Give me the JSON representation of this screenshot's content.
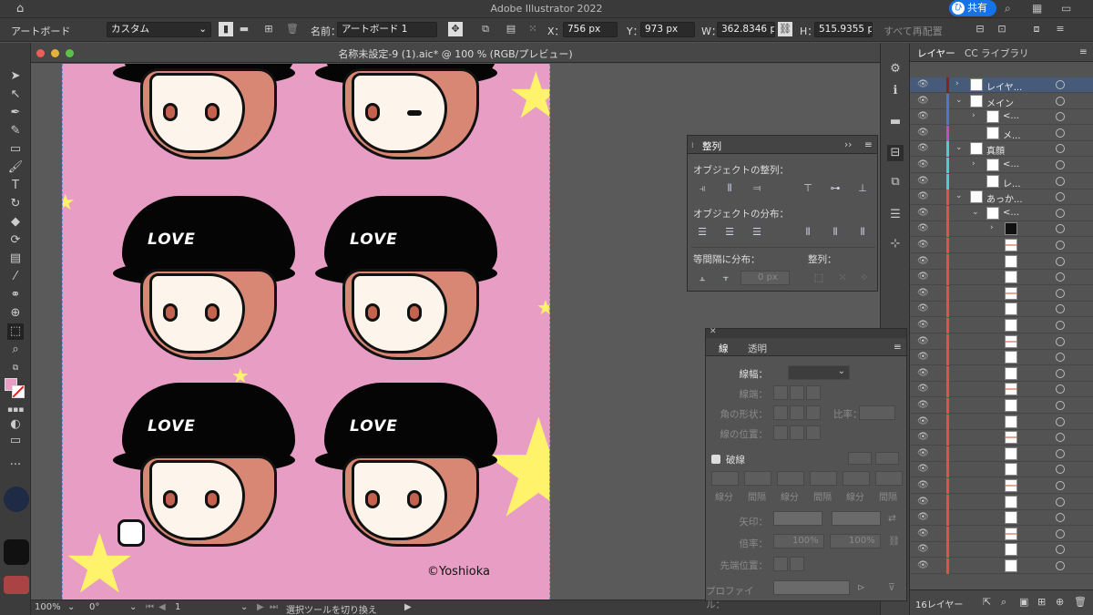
{
  "app": {
    "title": "Adobe Illustrator 2022",
    "share_label": "共有",
    "share_avatar": "ひ"
  },
  "control_bar": {
    "mode_label": "アートボード",
    "preset_value": "カスタム",
    "name_label": "名前：",
    "name_value": "アートボード 1",
    "x_label": "X：",
    "x_value": "756 px",
    "y_label": "Y：",
    "y_value": "973 px",
    "w_label": "W：",
    "w_value": "362.8346 p",
    "h_label": "H：",
    "h_value": "515.9355 p",
    "rearrange_label": "すべて再配置"
  },
  "document": {
    "title": "名称未設定-9 (1).aic* @ 100 % (RGB/プレビュー)"
  },
  "artwork": {
    "love_text": "LOVE",
    "copyright": "©Yoshioka"
  },
  "status_bar": {
    "zoom": "100%",
    "rotation": "0°",
    "artboard_num": "1",
    "tool_hint": "選択ツールを切り換え"
  },
  "align_panel": {
    "tab": "整列",
    "align_objects_label": "オブジェクトの整列：",
    "distribute_objects_label": "オブジェクトの分布：",
    "distribute_spacing_label": "等間隔に分布：",
    "align_to_label": "整列：",
    "spacing_value": "0 px"
  },
  "stroke_panel": {
    "tabs": [
      "線",
      "透明"
    ],
    "weight_label": "線幅：",
    "cap_label": "線端：",
    "corner_label": "角の形状：",
    "limit_label": "比率：",
    "align_label": "線の位置：",
    "dashed_label": "破線",
    "dash_labels": [
      "線分",
      "間隔",
      "線分",
      "間隔",
      "線分",
      "間隔"
    ],
    "arrowheads_label": "矢印：",
    "scale_label": "倍率：",
    "scale_value_1": "100%",
    "scale_value_2": "100%",
    "tip_label": "先端位置：",
    "profile_label": "プロファイル："
  },
  "layers_panel": {
    "tabs": [
      "レイヤー",
      "CC ライブラリ"
    ],
    "rows": [
      {
        "name": "レイヤ...",
        "color": "#8b2020",
        "level": 0,
        "expand": "›"
      },
      {
        "name": "メイン",
        "color": "#5a6ed6",
        "level": 0,
        "expand": "⌄"
      },
      {
        "name": "<...",
        "color": "#5a6ed6",
        "level": 1,
        "expand": "›"
      },
      {
        "name": "メ...",
        "color": "#c04ad0",
        "level": 1,
        "expand": ""
      },
      {
        "name": "真顔",
        "color": "#4ad0c8",
        "level": 0,
        "expand": "⌄"
      },
      {
        "name": "<...",
        "color": "#4ad0c8",
        "level": 1,
        "expand": "›"
      },
      {
        "name": "レ...",
        "color": "#4ad0c8",
        "level": 1,
        "expand": ""
      },
      {
        "name": "あっか...",
        "color": "#e05050",
        "level": 0,
        "expand": "⌄"
      },
      {
        "name": "<...",
        "color": "#e05050",
        "level": 1,
        "expand": "⌄"
      }
    ],
    "footer_count": "16レイヤー"
  }
}
